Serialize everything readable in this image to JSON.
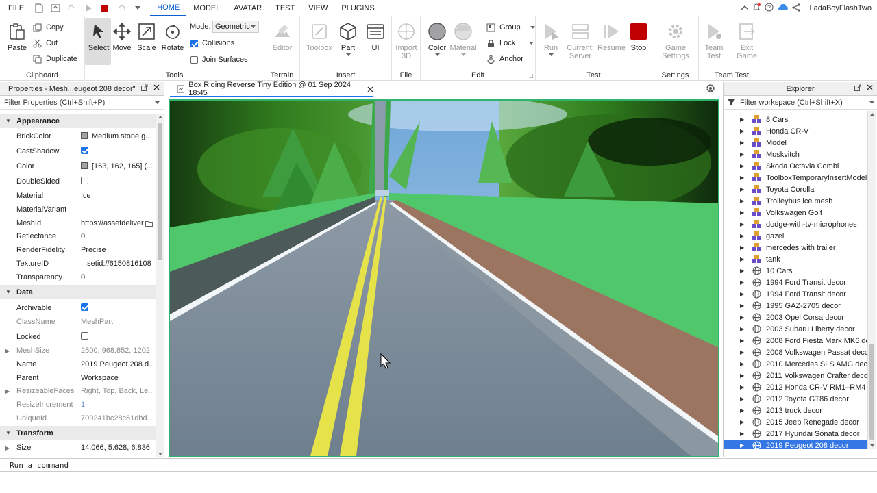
{
  "menu": {
    "file": "FILE",
    "tabs": [
      "HOME",
      "MODEL",
      "AVATAR",
      "TEST",
      "VIEW",
      "PLUGINS"
    ],
    "active_tab": "HOME",
    "username": "LadaBoyFlashTwo"
  },
  "ribbon": {
    "clipboard": {
      "paste": "Paste",
      "copy": "Copy",
      "cut": "Cut",
      "duplicate": "Duplicate",
      "label": "Clipboard"
    },
    "tools": {
      "select": "Select",
      "move": "Move",
      "scale": "Scale",
      "rotate": "Rotate",
      "mode_label": "Mode:",
      "mode_value": "Geometric",
      "collisions": "Collisions",
      "join_surfaces": "Join Surfaces",
      "label": "Tools"
    },
    "terrain": {
      "editor": "Editor",
      "label": "Terrain"
    },
    "insert": {
      "toolbox": "Toolbox",
      "part": "Part",
      "ui": "UI",
      "label": "Insert"
    },
    "file": {
      "import3d_line1": "Import",
      "import3d_line2": "3D",
      "label": "File"
    },
    "edit": {
      "color": "Color",
      "material": "Material",
      "group": "Group",
      "lock": "Lock",
      "anchor": "Anchor",
      "label": "Edit"
    },
    "test": {
      "run": "Run",
      "current_line1": "Current:",
      "current_line2": "Server",
      "resume": "Resume",
      "stop": "Stop",
      "label": "Test"
    },
    "settings": {
      "game_line1": "Game",
      "game_line2": "Settings",
      "label": "Settings"
    },
    "team_test": {
      "team_line1": "Team",
      "team_line2": "Test",
      "exit_line1": "Exit",
      "exit_line2": "Game",
      "label": "Team Test"
    }
  },
  "properties": {
    "title": "Properties - Mesh...eugeot 208 decor\"",
    "filter": "Filter Properties (Ctrl+Shift+P)",
    "cat_appearance": "Appearance",
    "cat_data": "Data",
    "cat_transform": "Transform",
    "appearance": [
      {
        "name": "BrickColor",
        "value": "Medium stone g..."
      },
      {
        "name": "CastShadow",
        "value": ""
      },
      {
        "name": "Color",
        "value": "[163, 162, 165] (..."
      },
      {
        "name": "DoubleSided",
        "value": ""
      },
      {
        "name": "Material",
        "value": "Ice"
      },
      {
        "name": "MaterialVariant",
        "value": ""
      },
      {
        "name": "MeshId",
        "value": "https://assetdeliver"
      },
      {
        "name": "Reflectance",
        "value": "0"
      },
      {
        "name": "RenderFidelity",
        "value": "Precise"
      },
      {
        "name": "TextureID",
        "value": "...setid://6150816108"
      },
      {
        "name": "Transparency",
        "value": "0"
      }
    ],
    "data": [
      {
        "name": "Archivable",
        "value": ""
      },
      {
        "name": "ClassName",
        "value": "MeshPart"
      },
      {
        "name": "Locked",
        "value": ""
      },
      {
        "name": "MeshSize",
        "value": "2500, 968.852, 1202...."
      },
      {
        "name": "Name",
        "value": "2019 Peugeot 208 d..."
      },
      {
        "name": "Parent",
        "value": "Workspace"
      },
      {
        "name": "ResizeableFaces",
        "value": "Right, Top, Back, Le..."
      },
      {
        "name": "ResizeIncrement",
        "value": "1"
      },
      {
        "name": "UniqueId",
        "value": "709241bc28c61dbd..."
      }
    ],
    "transform": [
      {
        "name": "Size",
        "value": "14.066, 5.628, 6.836"
      }
    ]
  },
  "document_tab": "Box Riding Reverse Tiny Edition @ 01 Sep 2024 18:45",
  "explorer": {
    "title": "Explorer",
    "filter": "Filter workspace (Ctrl+Shift+X)",
    "items": [
      {
        "label": "8 Cars",
        "kind": "model"
      },
      {
        "label": "Honda CR-V",
        "kind": "model"
      },
      {
        "label": "Model",
        "kind": "model"
      },
      {
        "label": "Moskvitch",
        "kind": "model"
      },
      {
        "label": "Skoda Octavia Combi",
        "kind": "model"
      },
      {
        "label": "ToolboxTemporaryInsertModel",
        "kind": "model"
      },
      {
        "label": "Toyota Corolla",
        "kind": "model"
      },
      {
        "label": "Trolleybus ice mesh",
        "kind": "model"
      },
      {
        "label": "Volkswagen Golf",
        "kind": "model"
      },
      {
        "label": "dodge-with-tv-microphones",
        "kind": "model"
      },
      {
        "label": "gazel",
        "kind": "model"
      },
      {
        "label": "mercedes with trailer",
        "kind": "model"
      },
      {
        "label": "tank",
        "kind": "model"
      },
      {
        "label": "10 Cars",
        "kind": "mesh"
      },
      {
        "label": "1994 Ford Transit decor",
        "kind": "mesh"
      },
      {
        "label": "1994 Ford Transit decor",
        "kind": "mesh"
      },
      {
        "label": "1995 GAZ-2705 decor",
        "kind": "mesh"
      },
      {
        "label": "2003 Opel Corsa decor",
        "kind": "mesh"
      },
      {
        "label": "2003 Subaru Liberty decor",
        "kind": "mesh"
      },
      {
        "label": "2008 Ford Fiesta Mark MK6 deco",
        "kind": "mesh"
      },
      {
        "label": "2008 Volkswagen Passat decor",
        "kind": "mesh"
      },
      {
        "label": "2010 Mercedes SLS AMG decor",
        "kind": "mesh"
      },
      {
        "label": "2011 Volkswagen Crafter decor",
        "kind": "mesh"
      },
      {
        "label": "2012 Honda CR-V RM1–RM4 deco",
        "kind": "mesh"
      },
      {
        "label": "2012 Toyota GT86 decor",
        "kind": "mesh"
      },
      {
        "label": "2013 truck decor",
        "kind": "mesh"
      },
      {
        "label": "2015 Jeep Renegade decor",
        "kind": "mesh"
      },
      {
        "label": "2017 Hyundai Sonata decor",
        "kind": "mesh"
      },
      {
        "label": "2019 Peugeot 208 decor",
        "kind": "mesh"
      }
    ]
  },
  "command_bar": {
    "placeholder": "Run a command"
  },
  "colors": {
    "accent": "#1a73e8",
    "selection": "#3578e5",
    "stop_red": "#c00000",
    "viewport_border": "#2fb36f"
  }
}
